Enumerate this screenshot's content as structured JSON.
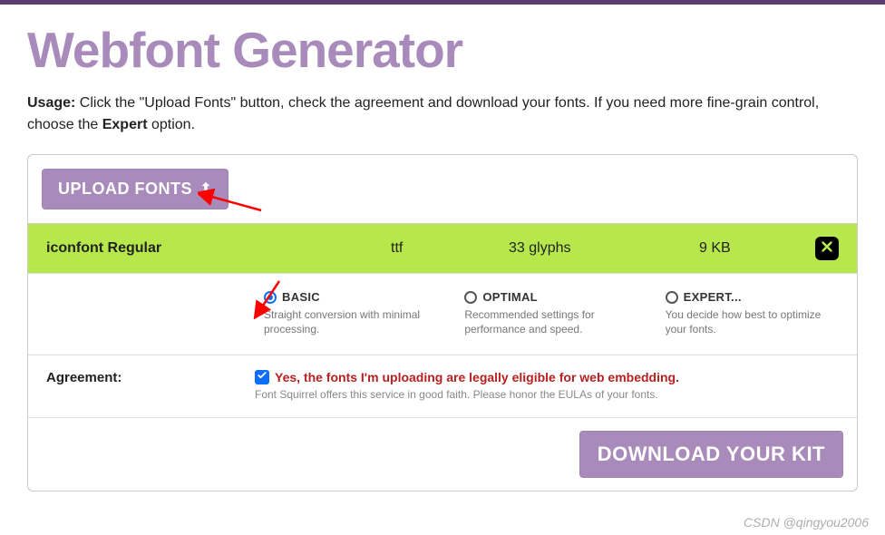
{
  "page": {
    "title": "Webfont Generator",
    "usage_prefix": "Usage:",
    "usage_body": " Click the \"Upload Fonts\" button, check the agreement and download your fonts. If you need more fine-grain control, choose the ",
    "usage_bold": "Expert",
    "usage_suffix": " option."
  },
  "upload": {
    "button_label": "UPLOAD FONTS"
  },
  "font_row": {
    "name": "iconfont Regular",
    "type": "ttf",
    "glyphs": "33 glyphs",
    "size": "9 KB"
  },
  "options": [
    {
      "label": "BASIC",
      "description": "Straight conversion with minimal processing.",
      "selected": true
    },
    {
      "label": "OPTIMAL",
      "description": "Recommended settings for performance and speed.",
      "selected": false
    },
    {
      "label": "EXPERT...",
      "description": "You decide how best to optimize your fonts.",
      "selected": false
    }
  ],
  "agreement": {
    "label": "Agreement:",
    "checked": true,
    "text": "Yes, the fonts I'm uploading are legally eligible for web embedding.",
    "note": "Font Squirrel offers this service in good faith. Please honor the EULAs of your fonts."
  },
  "download": {
    "button_label": "DOWNLOAD YOUR KIT"
  },
  "watermark": "CSDN @qingyou2006"
}
